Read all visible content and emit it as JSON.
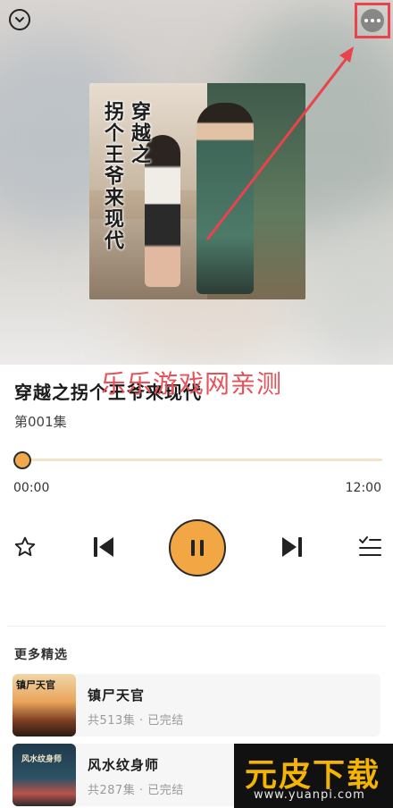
{
  "header": {
    "collapse_icon": "chevron-down-icon",
    "more_icon": "more-horizontal-icon"
  },
  "cover": {
    "title_col_right": "穿越之",
    "title_col_left": "拐个王爷来现代"
  },
  "watermark": "乐乐游戏网亲测",
  "track": {
    "title": "穿越之拐个王爷来现代",
    "episode": "第001集",
    "time_current": "00:00",
    "time_total": "12:00",
    "progress": 0
  },
  "controls": {
    "favorite_icon": "star-icon",
    "prev_icon": "skip-previous-icon",
    "play_state_icon": "pause-icon",
    "next_icon": "skip-next-icon",
    "playlist_icon": "playlist-icon"
  },
  "recommend": {
    "section_title": "更多精选",
    "items": [
      {
        "name": "镇尸天官",
        "meta": "共513集 · 已完结",
        "thumb_text": "镇尸天官"
      },
      {
        "name": "风水纹身师",
        "meta": "共287集 · 已完结",
        "thumb_text": "风水纹身师"
      }
    ]
  },
  "site_logo": {
    "main": "元皮下载",
    "url": "www.yuanpi.com"
  },
  "colors": {
    "accent": "#f3a644",
    "annotation_red": "#e9434b",
    "track": "#f3e4c6"
  }
}
